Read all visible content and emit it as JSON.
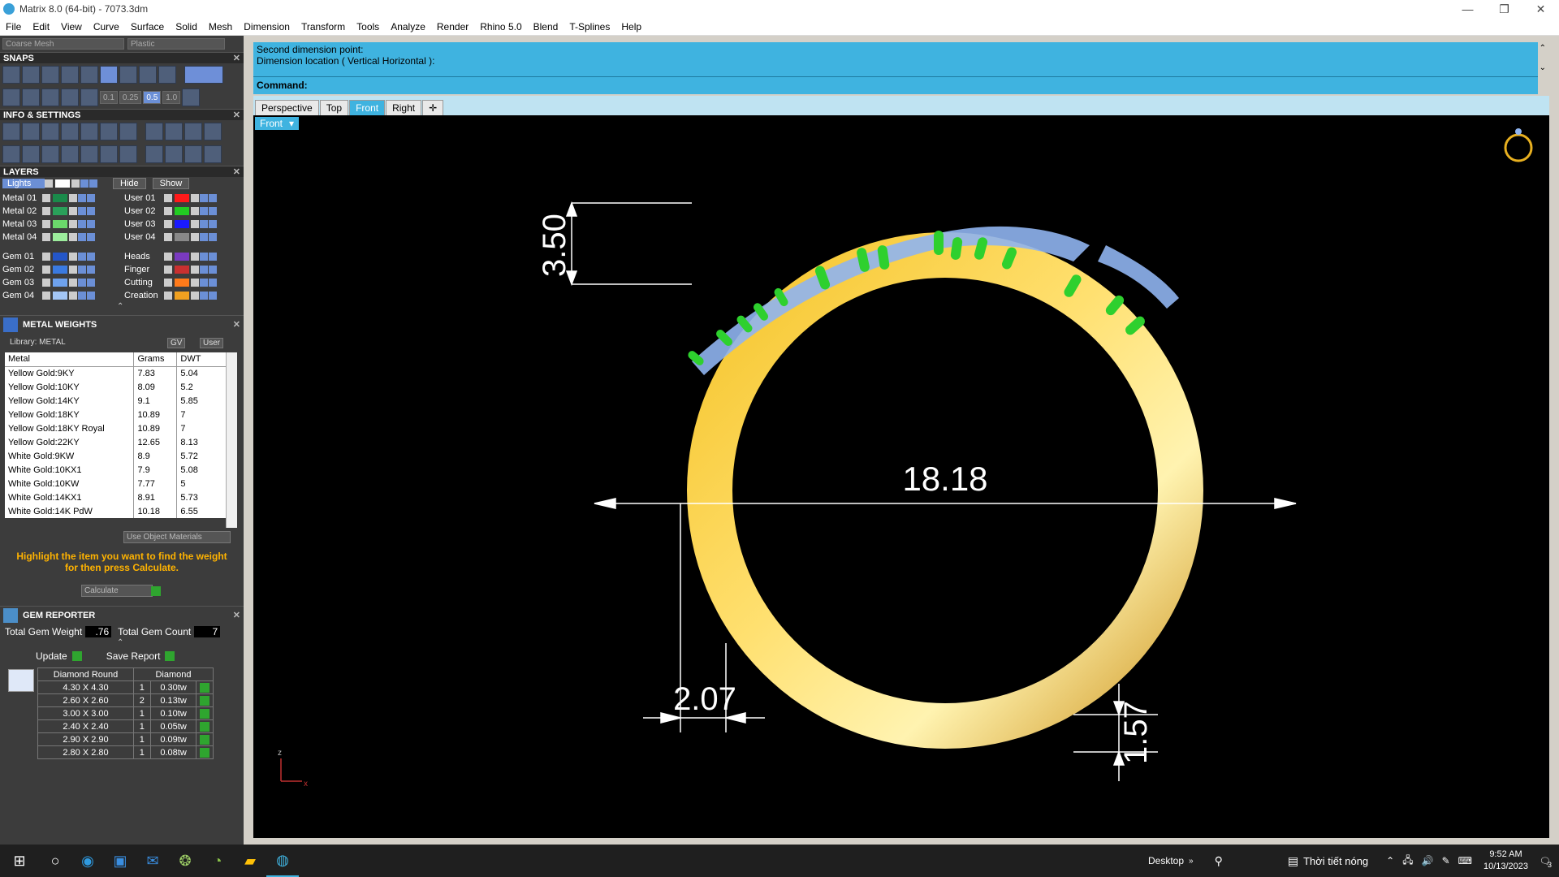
{
  "window": {
    "title": "Matrix 8.0 (64-bit) - 7073.3dm",
    "min": "—",
    "max": "❐",
    "close": "✕"
  },
  "menu": [
    "File",
    "Edit",
    "View",
    "Curve",
    "Surface",
    "Solid",
    "Mesh",
    "Dimension",
    "Transform",
    "Tools",
    "Analyze",
    "Render",
    "Rhino 5.0",
    "Blend",
    "T-Splines",
    "Help"
  ],
  "display": {
    "mesh": "Coarse Mesh",
    "material": "Plastic"
  },
  "snaps": {
    "title": "SNAPS",
    "values": [
      "0.1",
      "0.25",
      "0.5",
      "1.0"
    ]
  },
  "info": {
    "title": "INFO & SETTINGS"
  },
  "layers": {
    "title": "LAYERS",
    "lights": "Lights",
    "hide": "Hide",
    "show": "Show",
    "left": [
      {
        "name": "Metal 01",
        "color": "#1a8a4a"
      },
      {
        "name": "Metal 02",
        "color": "#2aa05a"
      },
      {
        "name": "Metal 03",
        "color": "#6bd86b"
      },
      {
        "name": "Metal 04",
        "color": "#9cec9c"
      },
      {
        "name": "Gem 01",
        "color": "#2456c8"
      },
      {
        "name": "Gem 02",
        "color": "#3a7ae0"
      },
      {
        "name": "Gem 03",
        "color": "#6ea2ee"
      },
      {
        "name": "Gem 04",
        "color": "#a3c6f5"
      }
    ],
    "right": [
      {
        "name": "User 01",
        "color": "#ff1a1a"
      },
      {
        "name": "User 02",
        "color": "#22cc22"
      },
      {
        "name": "User 03",
        "color": "#1a1aff"
      },
      {
        "name": "User 04",
        "color": "#888888"
      },
      {
        "name": "Heads",
        "color": "#7a3ac0"
      },
      {
        "name": "Finger",
        "color": "#c83030"
      },
      {
        "name": "Cutting",
        "color": "#ff7a1a"
      },
      {
        "name": "Creation",
        "color": "#f0a020"
      }
    ]
  },
  "metal_weights": {
    "title": "METAL WEIGHTS",
    "library": "Library: METAL",
    "gv": "GV",
    "user": "User",
    "headers": [
      "Metal",
      "Grams",
      "DWT"
    ],
    "rows": [
      [
        "Yellow Gold:9KY",
        "7.83",
        "5.04"
      ],
      [
        "Yellow Gold:10KY",
        "8.09",
        "5.2"
      ],
      [
        "Yellow Gold:14KY",
        "9.1",
        "5.85"
      ],
      [
        "Yellow Gold:18KY",
        "10.89",
        "7"
      ],
      [
        "Yellow Gold:18KY Royal",
        "10.89",
        "7"
      ],
      [
        "Yellow Gold:22KY",
        "12.65",
        "8.13"
      ],
      [
        "White Gold:9KW",
        "8.9",
        "5.72"
      ],
      [
        "White Gold:10KX1",
        "7.9",
        "5.08"
      ],
      [
        "White Gold:10KW",
        "7.77",
        "5"
      ],
      [
        "White Gold:14KX1",
        "8.91",
        "5.73"
      ],
      [
        "White Gold:14K PdW",
        "10.18",
        "6.55"
      ]
    ],
    "use_object_materials": "Use Object Materials",
    "hint": "Highlight the item you want to find the weight for then press Calculate.",
    "calculate": "Calculate"
  },
  "gem_reporter": {
    "title": "GEM REPORTER",
    "total_weight_label": "Total Gem Weight",
    "total_weight": ".76",
    "total_count_label": "Total Gem Count",
    "total_count": "7",
    "update": "Update",
    "save_report": "Save Report",
    "headers": [
      "Diamond Round",
      "Diamond"
    ],
    "rows": [
      [
        "4.30 X 4.30",
        "1",
        "0.30tw"
      ],
      [
        "2.60 X 2.60",
        "2",
        "0.13tw"
      ],
      [
        "3.00 X 3.00",
        "1",
        "0.10tw"
      ],
      [
        "2.40 X 2.40",
        "1",
        "0.05tw"
      ],
      [
        "2.90 X 2.90",
        "1",
        "0.09tw"
      ],
      [
        "2.80 X 2.80",
        "1",
        "0.08tw"
      ]
    ]
  },
  "command": {
    "line1": "Second dimension point:",
    "line2": "Dimension location ( Vertical  Horizontal ):",
    "label": "Command:"
  },
  "tabs": [
    "Perspective",
    "Top",
    "Front",
    "Right"
  ],
  "active_tab": "Front",
  "viewport": {
    "label": "Front",
    "dims": {
      "top_height": "3.50",
      "inner_diameter": "18.18",
      "band_width": "2.07",
      "thickness": "1.57"
    },
    "axis_z": "z",
    "axis_x": "x",
    "colors": {
      "gold": "#e8b020",
      "prong": "#2ed02e",
      "gem": "#8fb4f0"
    }
  },
  "taskbar": {
    "desktop": "Desktop",
    "weather": "Thời tiết nóng",
    "time": "9:52 AM",
    "date": "10/13/2023",
    "notif": "3"
  }
}
